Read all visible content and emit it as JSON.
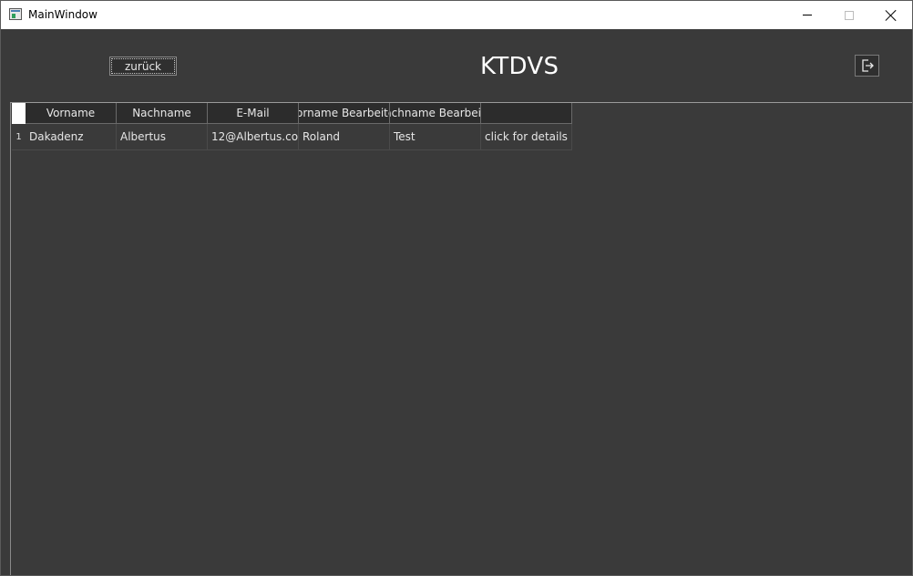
{
  "window": {
    "title": "MainWindow",
    "controls": [
      "minimize",
      "maximize",
      "close"
    ]
  },
  "toolbar": {
    "back_label": "zurück",
    "heading": "KTDVS",
    "logout_icon": "logout-icon"
  },
  "table": {
    "columns": [
      "Vorname",
      "Nachname",
      "E-Mail",
      "'orname Bearbeite",
      "achname Bearbeit",
      ""
    ],
    "rows": [
      {
        "index": "1",
        "cells": [
          "Dakadenz",
          "Albertus",
          "12@Albertus.co...",
          "Roland",
          "Test",
          "click for details"
        ]
      }
    ]
  },
  "colors": {
    "background": "#3a3a3a",
    "header_background": "#2c2c2c",
    "text": "#e6e6e6"
  }
}
